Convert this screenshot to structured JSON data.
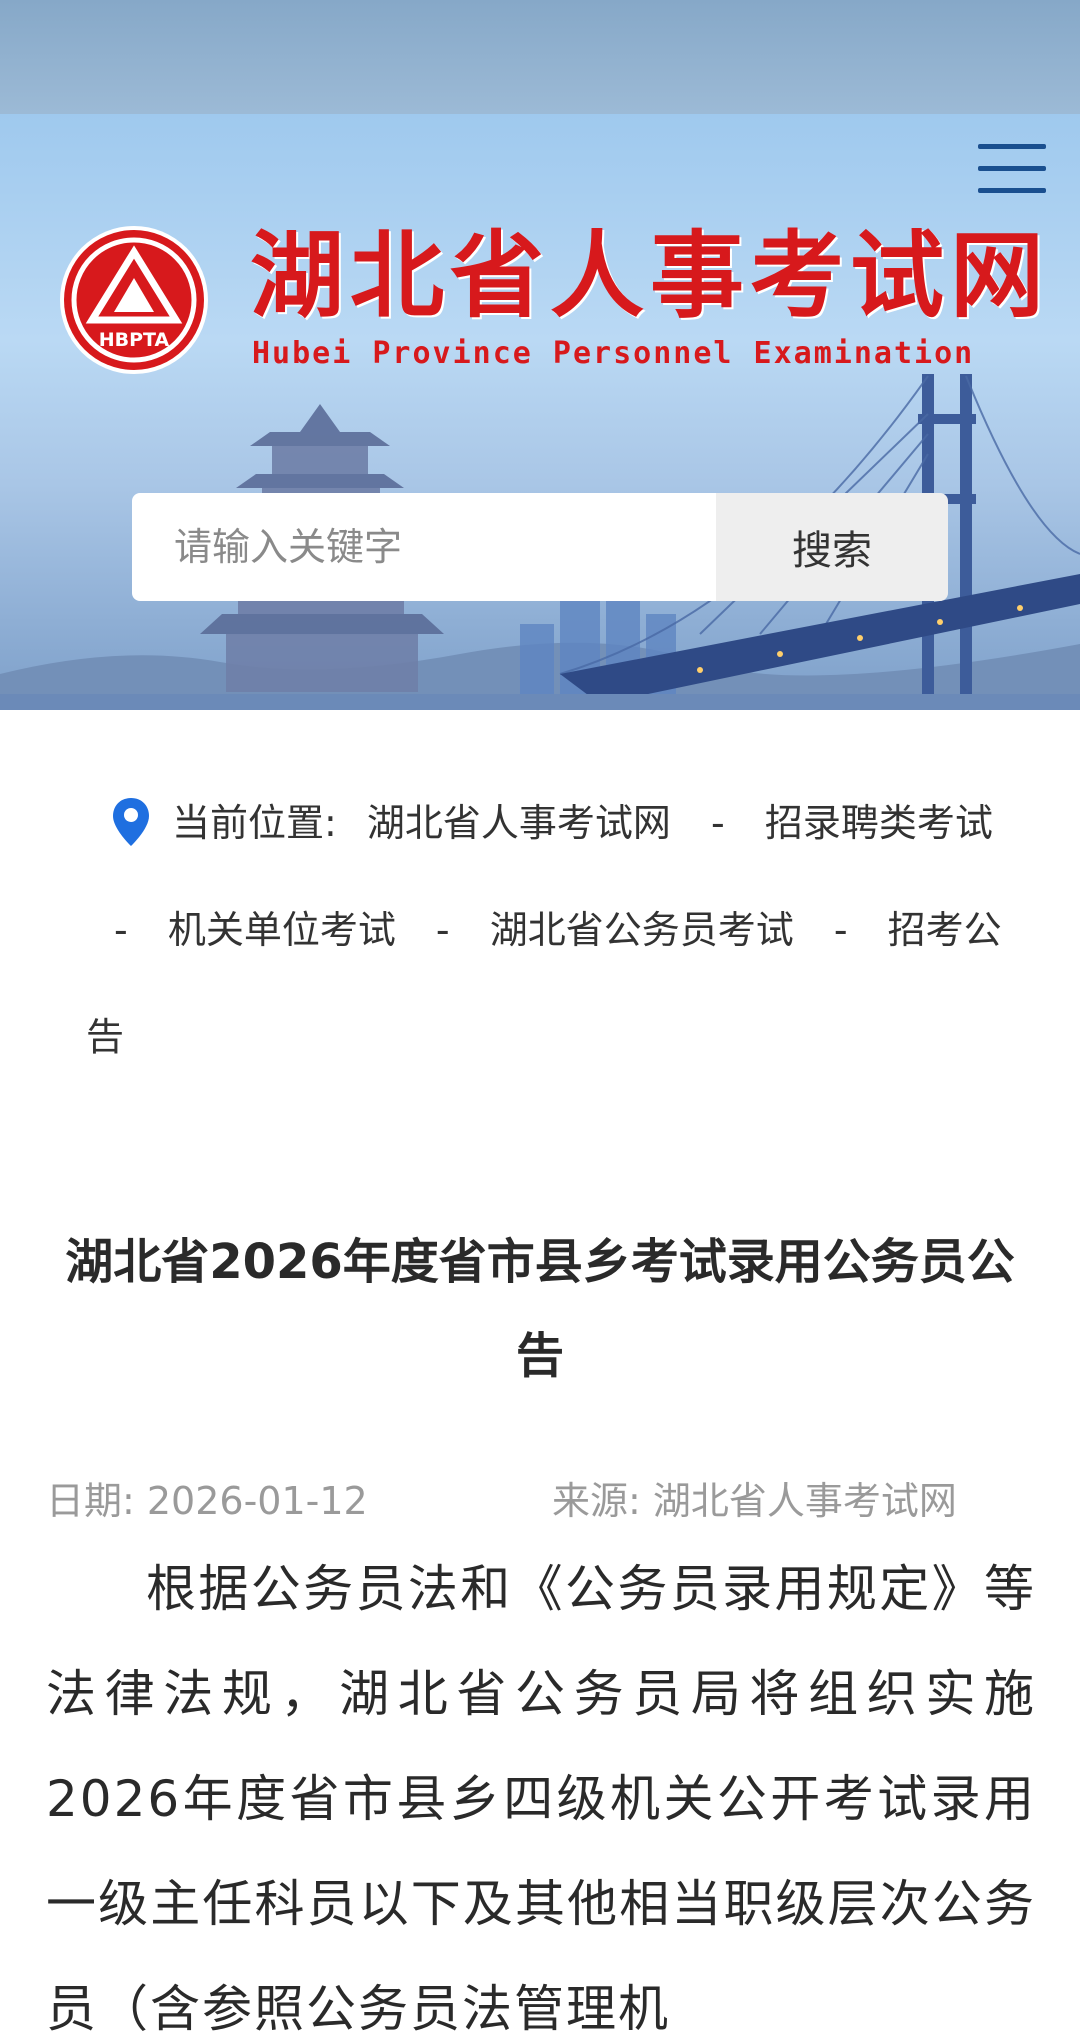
{
  "header": {
    "site_title": "湖北省人事考试网",
    "site_subtitle": "Hubei Province Personnel Examination",
    "logo_text": "HBPTA",
    "menu_icon": "hamburger-menu-icon"
  },
  "search": {
    "placeholder": "请输入关键字",
    "button_label": "搜索"
  },
  "breadcrumb": {
    "icon": "location-pin-icon",
    "label": "当前位置:",
    "separator": "-",
    "items": [
      "湖北省人事考试网",
      "招录聘类考试",
      "机关单位考试",
      "湖北省公务员考试",
      "招考公告"
    ]
  },
  "article": {
    "title": "湖北省2026年度省市县乡考试录用公务员公告",
    "date": "日期: 2026-01-12",
    "source": "来源: 湖北省人事考试网",
    "body": "根据公务员法和《公务员录用规定》等法律法规，湖北省公务员局将组织实施2026年度省市县乡四级机关公开考试录用一级主任科员以下及其他相当职级层次公务员（含参照公务员法管理机"
  },
  "colors": {
    "brand_red": "#d7191c",
    "menu_blue": "#1a4f8f",
    "pin_blue": "#1f6fe0"
  }
}
